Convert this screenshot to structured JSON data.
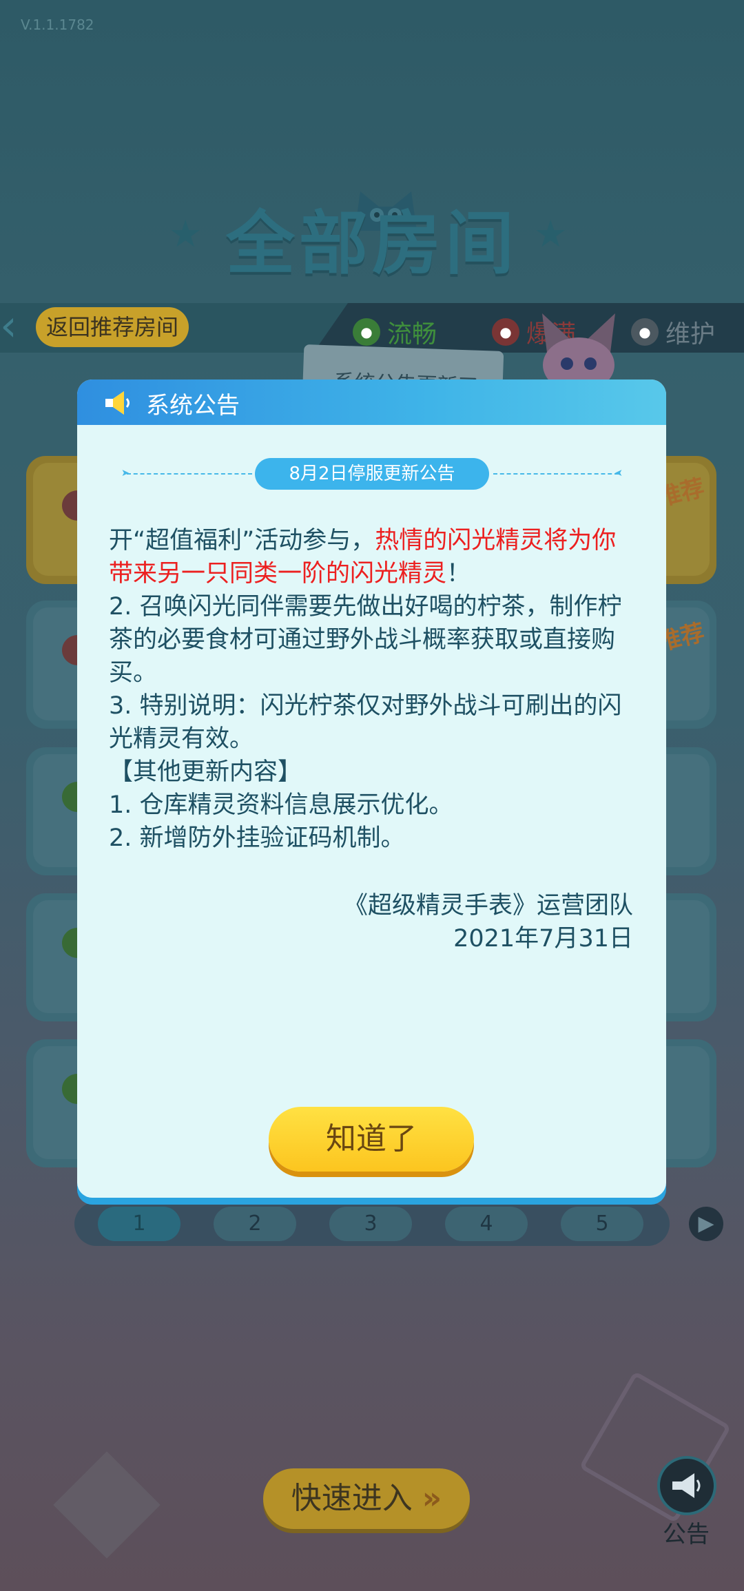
{
  "version": "V.1.1.1782",
  "page_title": "全部房间",
  "nav": {
    "back_label": "返回推荐房间",
    "status_smooth": "流畅",
    "status_hot": "爆满",
    "status_maintain": "维护"
  },
  "notice_card_text": "系统公告更新了",
  "room_tag": "推荐",
  "pagination": [
    "1",
    "2",
    "3",
    "4",
    "5"
  ],
  "quick_enter_label": "快速进入",
  "announcement_label": "公告",
  "dialog": {
    "title": "系统公告",
    "subtitle": "8月2日停服更新公告",
    "line1_pre": "开“超值福利”活动参与，",
    "line1_red": "热情的闪光精灵将为你带来另一只同类一阶的闪光精灵",
    "line1_post": "！",
    "line2": "2. 召唤闪光同伴需要先做出好喝的柠茶，制作柠茶的必要食材可通过野外战斗概率获取或直接购买。",
    "line3": "3. 特别说明：闪光柠茶仅对野外战斗可刷出的闪光精灵有效。",
    "section_heading": "【其他更新内容】",
    "update1": "1. 仓库精灵资料信息展示优化。",
    "update2": "2. 新增防外挂验证码机制。",
    "signature": "《超级精灵手表》运营团队",
    "date": "2021年7月31日",
    "ok_label": "知道了"
  },
  "colors": {
    "dialog_bg": "#e1f8f9",
    "header_blue": "#2f8fe0",
    "highlight_red": "#ec2020",
    "ok_yellow": "#fcc51f"
  }
}
